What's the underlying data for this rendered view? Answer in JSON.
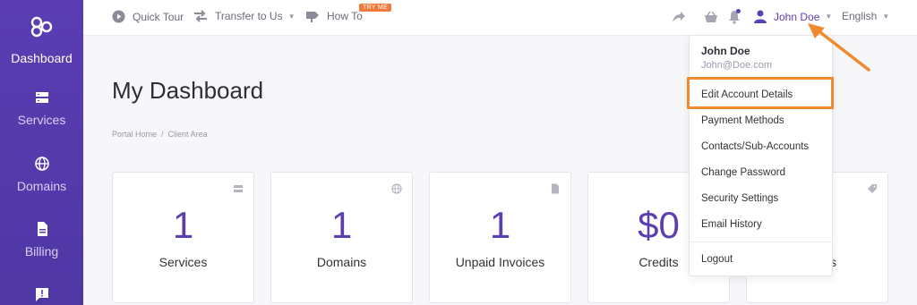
{
  "sidebar": {
    "items": [
      {
        "label": "Dashboard",
        "icon": "logo-icon"
      },
      {
        "label": "Services",
        "icon": "server-icon"
      },
      {
        "label": "Domains",
        "icon": "globe-icon"
      },
      {
        "label": "Billing",
        "icon": "document-icon"
      },
      {
        "label": "",
        "icon": "support-icon"
      }
    ]
  },
  "topbar": {
    "quick_tour": "Quick Tour",
    "transfer": "Transfer to Us",
    "how_to": "How To",
    "try_me": "TRY ME",
    "user": "John Doe",
    "language": "English"
  },
  "main": {
    "title": "My Dashboard",
    "breadcrumb": [
      "Portal Home",
      "Client Area"
    ]
  },
  "cards": [
    {
      "value": "1",
      "label": "Services",
      "icon": "server-icon"
    },
    {
      "value": "1",
      "label": "Domains",
      "icon": "globe-icon"
    },
    {
      "value": "1",
      "label": "Unpaid Invoices",
      "icon": "document-icon"
    },
    {
      "value": "$0",
      "label": "Credits",
      "icon": "wallet-icon"
    },
    {
      "value": "",
      "label": "s",
      "icon": "tag-icon"
    }
  ],
  "dropdown": {
    "name": "John Doe",
    "email": "John@Doe.com",
    "items": [
      "Edit Account Details",
      "Payment Methods",
      "Contacts/Sub-Accounts",
      "Change Password",
      "Security Settings",
      "Email History"
    ],
    "logout": "Logout"
  },
  "colors": {
    "accent": "#5b3fb0",
    "highlight": "#f08a2e"
  }
}
